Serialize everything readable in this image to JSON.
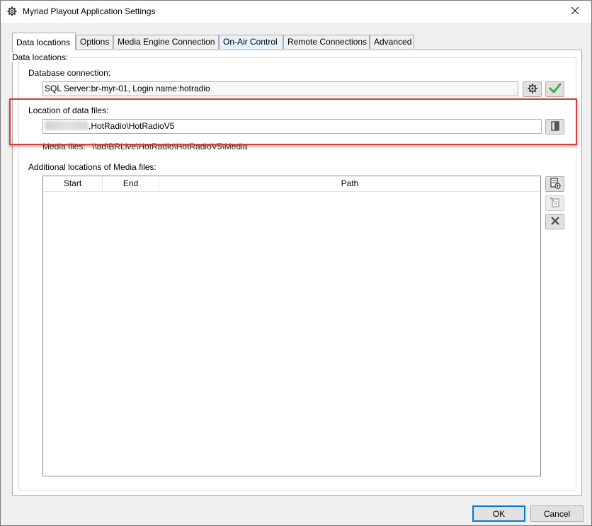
{
  "window": {
    "title": "Myriad Playout Application Settings",
    "title_icon": "gear-icon",
    "close_icon": "close-icon"
  },
  "tabs": [
    {
      "label": "Data locations",
      "active": true
    },
    {
      "label": "Options",
      "active": false
    },
    {
      "label": "Media Engine Connection",
      "active": false
    },
    {
      "label": "On-Air Control",
      "active": false
    },
    {
      "label": "Remote Connections",
      "active": false
    },
    {
      "label": "Advanced",
      "active": false
    }
  ],
  "data_locations": {
    "group_title": "Data locations:",
    "database_label": "Database connection:",
    "database_value": "SQL Server:br-myr-01, Login name:hotradio",
    "location_label": "Location of data files:",
    "location_value": ",HotRadio\\HotRadioV5",
    "media_files_label": "Media files:",
    "media_files_value": "\\\\ad\\BRLive\\HotRadio\\HotRadioV5\\Media",
    "additional_label": "Additional locations of Media files:",
    "columns": [
      "Start",
      "End",
      "Path"
    ],
    "rows": []
  },
  "buttons": {
    "ok": "OK",
    "cancel": "Cancel"
  },
  "colors": {
    "highlight": "#e03b3b",
    "check": "#3cb043",
    "accent": "#0078d7"
  }
}
